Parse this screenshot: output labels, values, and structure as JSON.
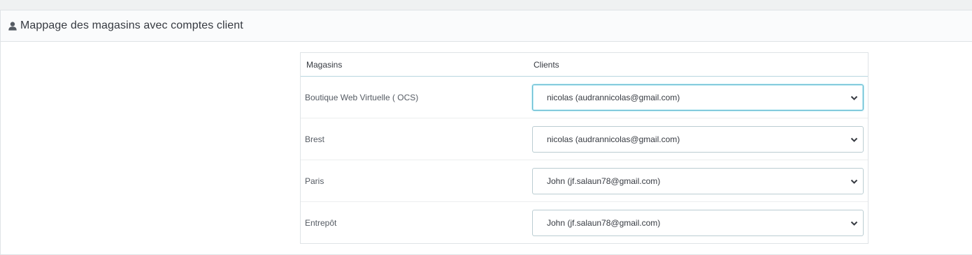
{
  "panel": {
    "title": "Mappage des magasins avec comptes client",
    "icon": "user-icon"
  },
  "table": {
    "headers": {
      "stores": "Magasins",
      "clients": "Clients"
    },
    "rows": [
      {
        "store": "Boutique Web Virtuelle ( OCS)",
        "client": "nicolas (audrannicolas@gmail.com)",
        "focused": true
      },
      {
        "store": "Brest",
        "client": "nicolas (audrannicolas@gmail.com)",
        "focused": false
      },
      {
        "store": "Paris",
        "client": "John (jf.salaun78@gmail.com)",
        "focused": false
      },
      {
        "store": "Entrepôt",
        "client": "John (jf.salaun78@gmail.com)",
        "focused": false
      }
    ]
  },
  "colors": {
    "border": "#dfe3e6",
    "header_border": "#b8d6e0",
    "select_border": "#bbcdd2",
    "focus_border": "#5fb8d0",
    "text": "#363a41"
  }
}
